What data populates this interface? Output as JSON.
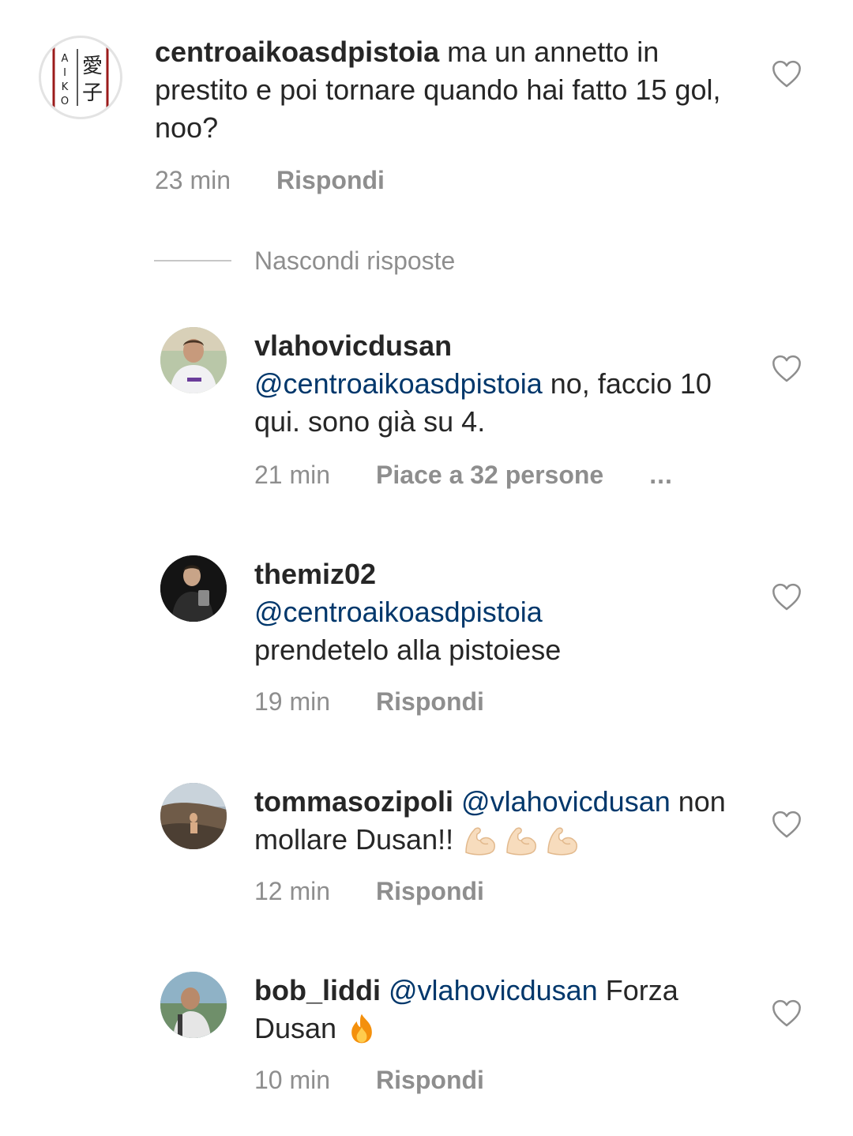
{
  "comments": [
    {
      "username": "centroaikoasdpistoia",
      "text": "ma un annetto in prestito e poi tornare quando hai fatto 15 gol, noo?",
      "time": "23 min",
      "action": "Rispondi",
      "avatar_letters": "A I K O",
      "avatar_kanji": "愛子"
    },
    {
      "username": "vlahovicdusan",
      "mention": "@centroaikoasdpistoia",
      "text": "no, faccio 10 qui. sono già su 4.",
      "time": "21 min",
      "action": "Piace a 32 persone",
      "more": "..."
    },
    {
      "username": "themiz02",
      "mention": "@centroaikoasdpistoia",
      "text": "prendetelo alla pistoiese",
      "time": "19 min",
      "action": "Rispondi"
    },
    {
      "username": "tommasozipoli",
      "mention": "@vlahovicdusan",
      "text": "non mollare Dusan!!",
      "time": "12 min",
      "action": "Rispondi",
      "emoji": "flexed-biceps x3"
    },
    {
      "username": "bob_liddi",
      "mention": "@vlahovicdusan",
      "text": "Forza Dusan",
      "time": "10 min",
      "action": "Rispondi",
      "emoji": "fire"
    }
  ],
  "replies_toggle": "Nascondi risposte",
  "colors": {
    "text": "#262626",
    "meta": "#8e8e8e",
    "mention": "#00376b"
  }
}
